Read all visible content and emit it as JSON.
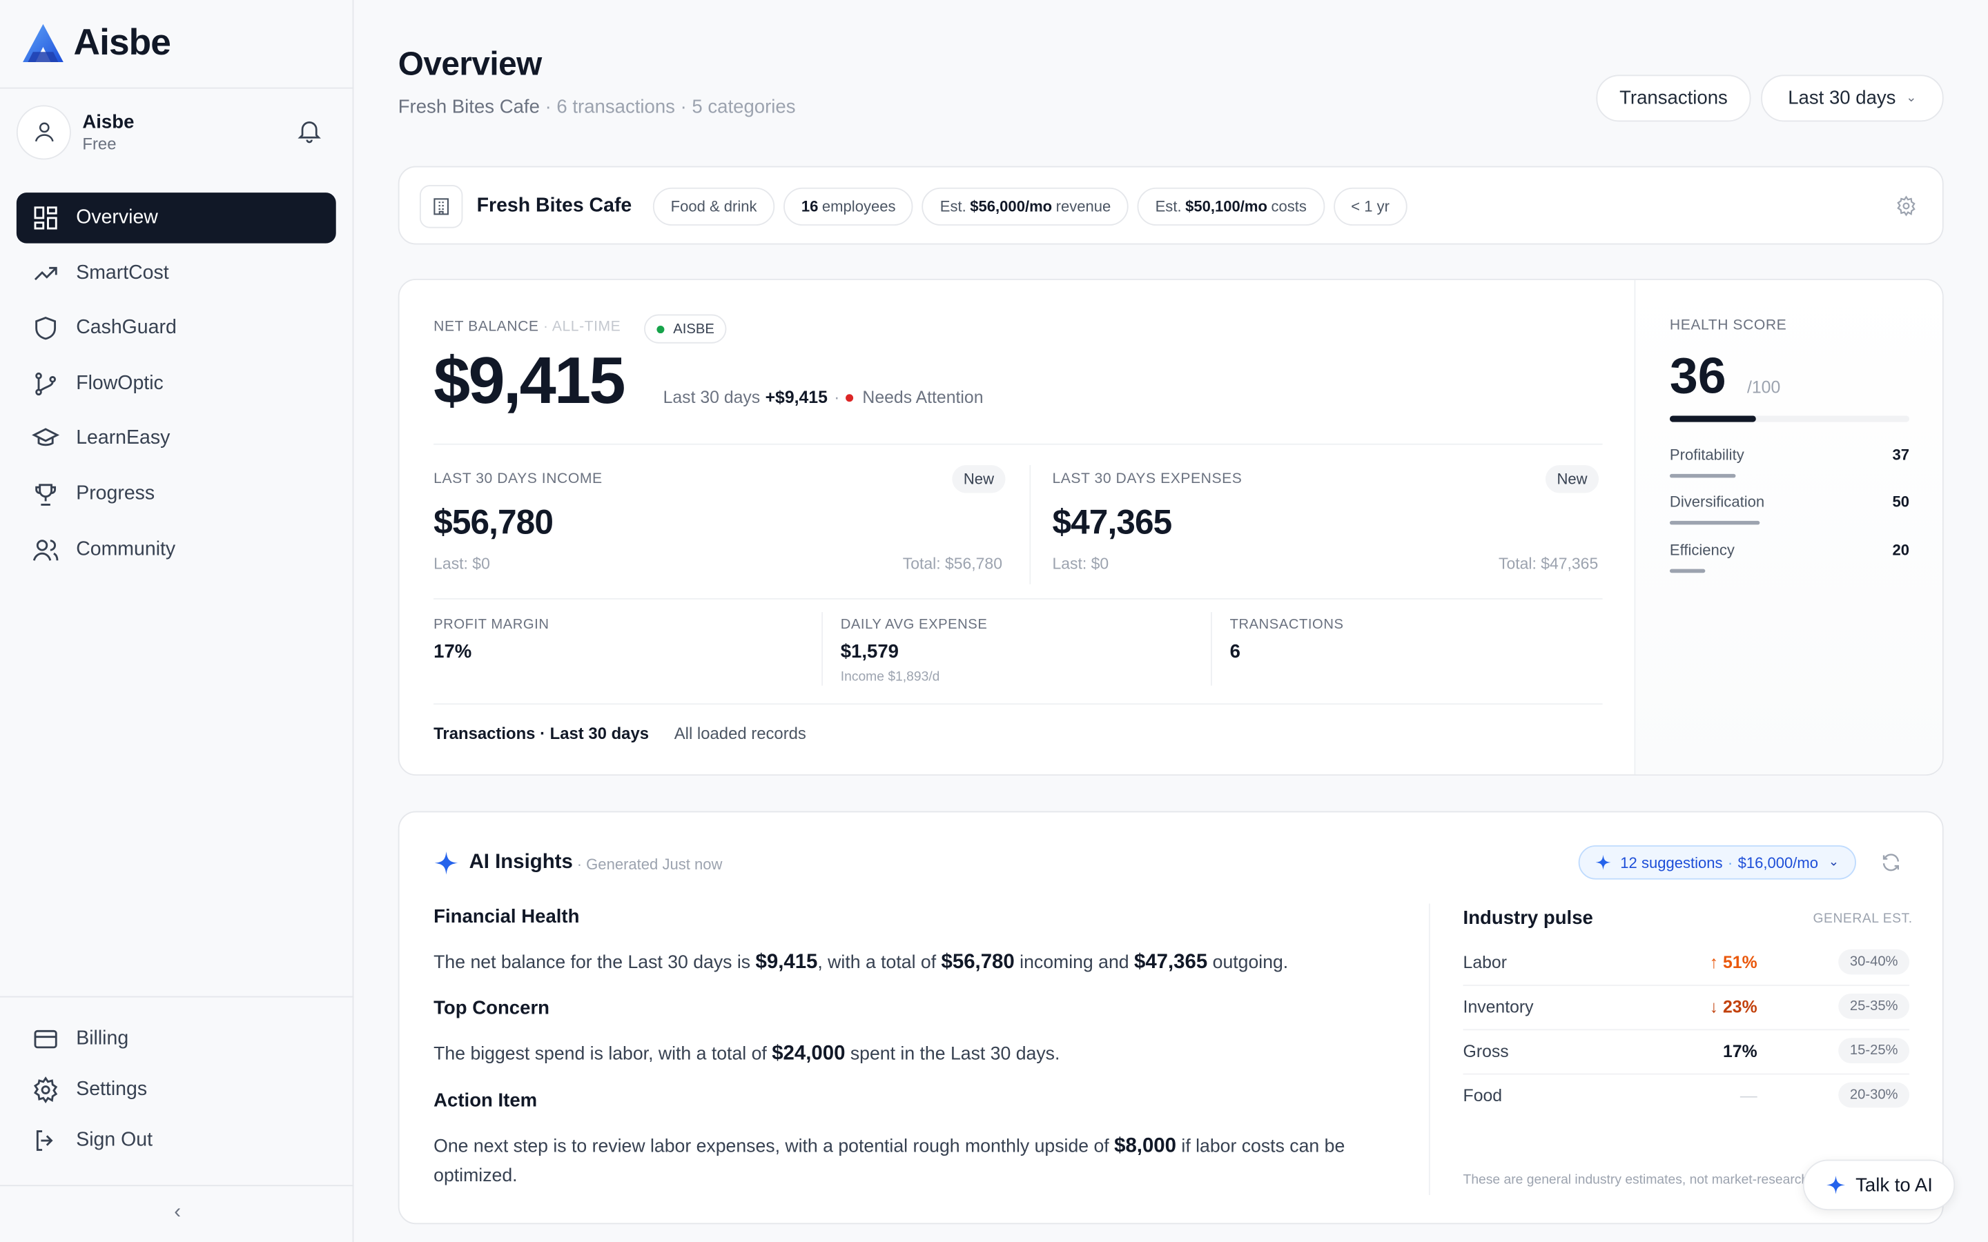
{
  "brand": {
    "name": "Aisbe"
  },
  "user": {
    "name": "Aisbe",
    "plan": "Free"
  },
  "nav": [
    {
      "label": "Overview",
      "icon": "grid-icon"
    },
    {
      "label": "SmartCost",
      "icon": "trend-up-icon"
    },
    {
      "label": "CashGuard",
      "icon": "shield-icon"
    },
    {
      "label": "FlowOptic",
      "icon": "branch-icon"
    },
    {
      "label": "LearnEasy",
      "icon": "graduation-cap-icon"
    },
    {
      "label": "Progress",
      "icon": "trophy-icon"
    },
    {
      "label": "Community",
      "icon": "users-icon"
    }
  ],
  "nav_bottom": [
    {
      "label": "Billing",
      "icon": "credit-card-icon"
    },
    {
      "label": "Settings",
      "icon": "gear-icon"
    },
    {
      "label": "Sign Out",
      "icon": "sign-out-icon"
    }
  ],
  "header": {
    "title": "Overview",
    "business": "Fresh Bites Cafe",
    "sub_rest": " · 6 transactions · 5 categories",
    "transactions_button": "Transactions",
    "range": "Last 30 days"
  },
  "business_card": {
    "name": "Fresh Bites Cafe",
    "chip_category": "Food & drink",
    "chip_employees_num": "16",
    "chip_employees_txt": "employees",
    "chip_rev_pre": "Est.",
    "chip_rev_val": "$56,000/mo",
    "chip_rev_txt": "revenue",
    "chip_cost_pre": "Est.",
    "chip_cost_val": "$50,100/mo",
    "chip_cost_txt": "costs",
    "chip_age": "< 1 yr"
  },
  "finance": {
    "net_label": "NET BALANCE",
    "net_label_scope": "· ALL-TIME",
    "badge": "AISBE",
    "net_value": "$9,415",
    "period_prefix": "Last 30 days",
    "period_change": "+$9,415",
    "status": "Needs Attention",
    "income_label": "LAST 30 DAYS INCOME",
    "income_badge": "New",
    "income_value": "$56,780",
    "income_last": "Last: $0",
    "income_total": "Total: $56,780",
    "expense_label": "LAST 30 DAYS EXPENSES",
    "expense_badge": "New",
    "expense_value": "$47,365",
    "expense_last": "Last: $0",
    "expense_total": "Total: $47,365",
    "margin_label": "PROFIT MARGIN",
    "margin_value": "17%",
    "daily_label": "DAILY AVG EXPENSE",
    "daily_value": "$1,579",
    "daily_sub": "Income $1,893/d",
    "tx_label": "TRANSACTIONS",
    "tx_value": "6",
    "foot_bold": "Transactions · Last 30 days",
    "foot_rest": "All loaded records"
  },
  "health": {
    "label": "HEALTH SCORE",
    "score": "36",
    "max": "/100",
    "score_fraction": 0.36,
    "items": [
      {
        "name": "Profitability",
        "value": "37",
        "fraction": 0.37
      },
      {
        "name": "Diversification",
        "value": "50",
        "fraction": 0.5
      },
      {
        "name": "Efficiency",
        "value": "20",
        "fraction": 0.2
      }
    ]
  },
  "ai": {
    "title": "AI Insights",
    "generated": "· Generated Just now",
    "suggestions": "12 suggestions",
    "suggestions_value": "$16,000/mo",
    "h1": "Financial Health",
    "p1_a": "The net balance for the Last 30 days is ",
    "p1_b": "$9,415",
    "p1_c": ", with a total of ",
    "p1_d": "$56,780",
    "p1_e": " incoming and ",
    "p1_f": "$47,365",
    "p1_g": " outgoing.",
    "h2": "Top Concern",
    "p2_a": "The biggest spend is labor, with a total of ",
    "p2_b": "$24,000",
    "p2_c": " spent in the Last 30 days.",
    "h3": "Action Item",
    "p3_a": "One next step is to review labor expenses, with a potential rough monthly upside of ",
    "p3_b": "$8,000",
    "p3_c": " if labor costs can be optimized."
  },
  "pulse": {
    "title": "Industry pulse",
    "est": "GENERAL EST.",
    "rows": [
      {
        "name": "Labor",
        "value": "↑ 51%",
        "range": "30-40%"
      },
      {
        "name": "Inventory",
        "value": "↓ 23%",
        "range": "25-35%"
      },
      {
        "name": "Gross",
        "value": "17%",
        "range": "15-25%"
      },
      {
        "name": "Food",
        "value": "—",
        "range": "20-30%"
      }
    ],
    "note": "These are general industry estimates, not market-research"
  },
  "talk": {
    "label": "Talk to AI"
  },
  "colors": {
    "accent": "#2563eb",
    "active_nav": "#111827",
    "alert": "#dc2626",
    "ok": "#16a34a"
  }
}
